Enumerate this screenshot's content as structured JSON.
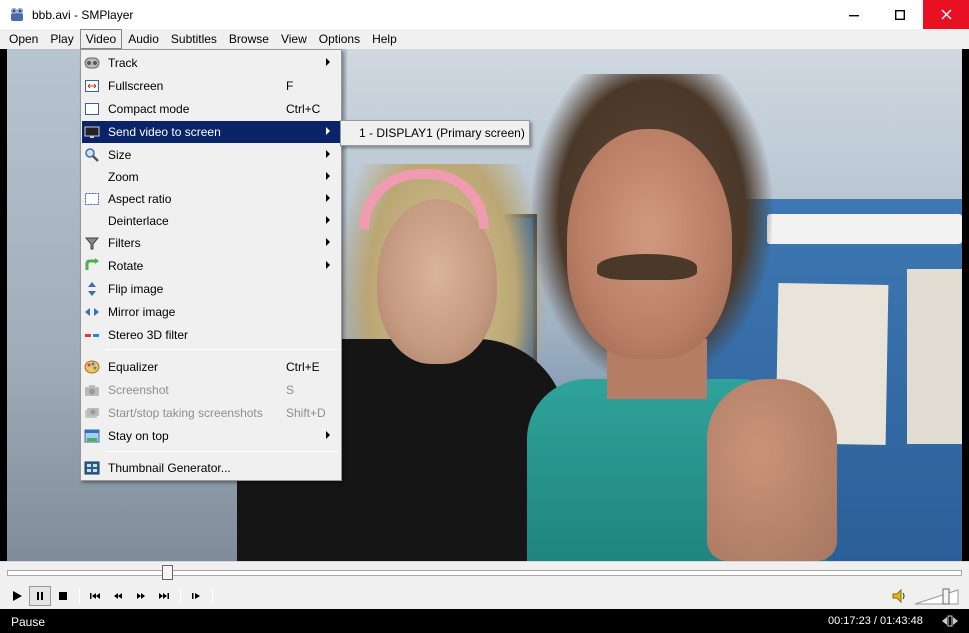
{
  "window": {
    "title": "bbb.avi - SMPlayer",
    "icon": "smplayer-app-icon"
  },
  "menubar": {
    "items": [
      {
        "label": "Open"
      },
      {
        "label": "Play"
      },
      {
        "label": "Video"
      },
      {
        "label": "Audio"
      },
      {
        "label": "Subtitles"
      },
      {
        "label": "Browse"
      },
      {
        "label": "View"
      },
      {
        "label": "Options"
      },
      {
        "label": "Help"
      }
    ],
    "active": "Video"
  },
  "video_menu": {
    "items": [
      {
        "label": "Track",
        "shortcut": "",
        "submenu": true,
        "icon": "track-icon",
        "enabled": true
      },
      {
        "label": "Fullscreen",
        "shortcut": "F",
        "submenu": false,
        "icon": "fullscreen-icon",
        "enabled": true
      },
      {
        "label": "Compact mode",
        "shortcut": "Ctrl+C",
        "submenu": false,
        "icon": "compact-mode-icon",
        "enabled": true
      },
      {
        "label": "Send video to screen",
        "shortcut": "",
        "submenu": true,
        "icon": "monitor-icon",
        "enabled": true,
        "highlighted": true
      },
      {
        "label": "Size",
        "shortcut": "",
        "submenu": true,
        "icon": "magnifier-icon",
        "enabled": true
      },
      {
        "label": "Zoom",
        "shortcut": "",
        "submenu": true,
        "icon": "",
        "enabled": true
      },
      {
        "label": "Aspect ratio",
        "shortcut": "",
        "submenu": true,
        "icon": "aspect-ratio-icon",
        "enabled": true
      },
      {
        "label": "Deinterlace",
        "shortcut": "",
        "submenu": true,
        "icon": "",
        "enabled": true
      },
      {
        "label": "Filters",
        "shortcut": "",
        "submenu": true,
        "icon": "funnel-icon",
        "enabled": true
      },
      {
        "label": "Rotate",
        "shortcut": "",
        "submenu": true,
        "icon": "rotate-icon",
        "enabled": true
      },
      {
        "label": "Flip image",
        "shortcut": "",
        "submenu": false,
        "icon": "flip-icon",
        "enabled": true
      },
      {
        "label": "Mirror image",
        "shortcut": "",
        "submenu": false,
        "icon": "mirror-icon",
        "enabled": true
      },
      {
        "label": "Stereo 3D filter",
        "shortcut": "",
        "submenu": false,
        "icon": "stereo-3d-icon",
        "enabled": true
      },
      {
        "label": "Equalizer",
        "shortcut": "Ctrl+E",
        "submenu": false,
        "icon": "palette-icon",
        "enabled": true
      },
      {
        "label": "Screenshot",
        "shortcut": "S",
        "submenu": false,
        "icon": "camera-icon",
        "enabled": false
      },
      {
        "label": "Start/stop taking screenshots",
        "shortcut": "Shift+D",
        "submenu": false,
        "icon": "camera-multi-icon",
        "enabled": false
      },
      {
        "label": "Stay on top",
        "shortcut": "",
        "submenu": true,
        "icon": "stay-on-top-icon",
        "enabled": true
      },
      {
        "label": "Thumbnail Generator...",
        "shortcut": "",
        "submenu": false,
        "icon": "thumbnail-icon",
        "enabled": true
      }
    ]
  },
  "submenu_send_to_screen": {
    "items": [
      {
        "label": "1 - DISPLAY1 (Primary screen)"
      }
    ]
  },
  "player": {
    "seek_progress": 0.168,
    "volume_level": 0.7
  },
  "status": {
    "state": "Pause",
    "time": "00:17:23 / 01:43:48"
  },
  "colors": {
    "highlight": "#0a246a",
    "close_button": "#e81123",
    "menu_bg": "#f0f0f0"
  }
}
